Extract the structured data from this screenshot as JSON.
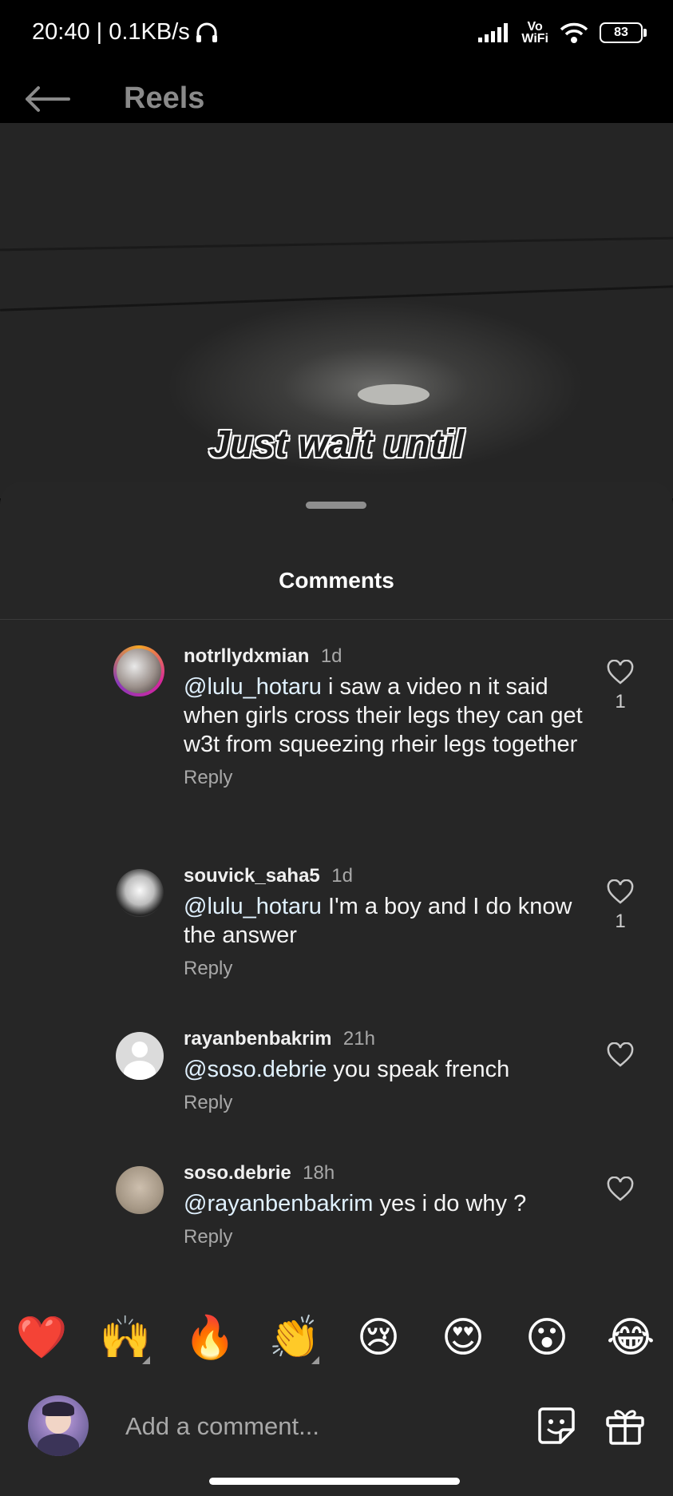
{
  "status": {
    "time_speed": "20:40 | 0.1KB/s",
    "volte_top": "Vo",
    "volte_bottom": "WiFi",
    "battery": "83"
  },
  "header": {
    "title": "Reels"
  },
  "video": {
    "caption_line1": "Just wait until"
  },
  "comments_panel": {
    "title": "Comments",
    "comments": [
      {
        "username": "notrllydxmian",
        "time": "1d",
        "mention": "@lulu_hotaru",
        "text": " i saw a video n it said when girls cross their legs they can get w3t from squeezing rheir legs together",
        "reply_label": "Reply",
        "likes": "1"
      },
      {
        "username": "souvick_saha5",
        "time": "1d",
        "mention": "@lulu_hotaru",
        "text": " I'm a boy and I do know the answer",
        "reply_label": "Reply",
        "likes": "1"
      },
      {
        "username": "rayanbenbakrim",
        "time": "21h",
        "mention": "@soso.debrie",
        "text": " you speak french",
        "reply_label": "Reply",
        "likes": ""
      },
      {
        "username": "soso.debrie",
        "time": "18h",
        "mention": "@rayanbenbakrim",
        "text": " yes i do why ?",
        "reply_label": "Reply",
        "likes": ""
      }
    ]
  },
  "emoji_bar": [
    "❤️",
    "🙌",
    "🔥",
    "👏",
    "😢",
    "😍",
    "😮",
    "😂"
  ],
  "composer": {
    "placeholder": "Add a comment..."
  },
  "colors": {
    "sheet_bg": "#262626",
    "secondary_text": "#a8a8a8",
    "mention": "#e0f1ff"
  }
}
